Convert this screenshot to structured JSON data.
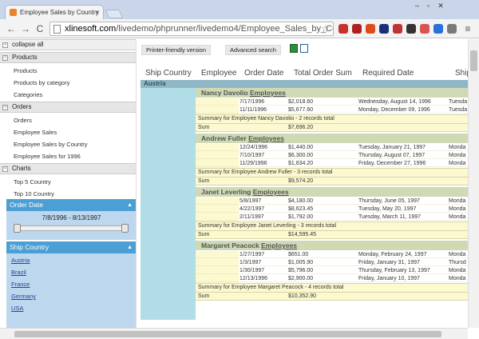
{
  "browser": {
    "tab_title": "Employee Sales by Country",
    "tab_close": "×",
    "url_host": "xlinesoft.com",
    "url_path": "/livedemo/phprunner/livedemo4/Employee_Sales_by_Country",
    "window_controls": "–▫✕",
    "back": "←",
    "forward": "→",
    "reload": "C",
    "star": "☆",
    "menu": "≡",
    "extension_colors": [
      "#c9302c",
      "#b02020",
      "#e04a1a",
      "#1a2f7a",
      "#c23232",
      "#333333",
      "#d9534f",
      "#2a6fdb",
      "#7a7a7a"
    ]
  },
  "sidebar": {
    "collapse_label": "collapse all",
    "sections": [
      {
        "toggle": "−",
        "title": "Products",
        "items": [
          "Products",
          "Products by category",
          "Categories"
        ]
      },
      {
        "toggle": "−",
        "title": "Orders",
        "items": [
          "Orders",
          "Employee Sales",
          "Employee Sales by Country",
          "Employee Sales for 1996"
        ]
      },
      {
        "toggle": "−",
        "title": "Charts",
        "items": [
          "Top 5 Country",
          "Top 10 Country"
        ]
      }
    ],
    "order_date": {
      "title": "Order Date",
      "range": "7/8/1996 - 8/13/1997"
    },
    "ship_country": {
      "title": "Ship Country",
      "countries": [
        "Austria",
        "Brazil",
        "France",
        "Germany",
        "USA"
      ]
    },
    "collapse_arrow": "▲"
  },
  "toolbar": {
    "printer_label": "Printer-friendly version",
    "search_label": "Advanced search"
  },
  "report": {
    "columns": [
      "Ship Country",
      "Employee",
      "Order Date",
      "Total Order Sum",
      "Required Date",
      "Ship"
    ],
    "country": "Austria",
    "employee_link": "Employees",
    "sum_label": "Sum",
    "groups": [
      {
        "name": "Nancy Davolio",
        "rows": [
          [
            "7/17/1996",
            "$2,018.60",
            "Wednesday, August 14, 1996",
            "Tuesda"
          ],
          [
            "11/11/1996",
            "$5,677.60",
            "Monday, December 09, 1996",
            "Tuesda"
          ]
        ],
        "summary": "Summary for Employee Nancy Davolio - 2 records total",
        "sum": "$7,696.20"
      },
      {
        "name": "Andrew Fuller",
        "rows": [
          [
            "12/24/1996",
            "$1,440.00",
            "Tuesday, January 21, 1997",
            "Monda"
          ],
          [
            "7/10/1997",
            "$6,300.00",
            "Thursday, August 07, 1997",
            "Monda"
          ],
          [
            "11/29/1996",
            "$1,834.20",
            "Friday, December 27, 1996",
            "Monda"
          ]
        ],
        "summary": "Summary for Employee Andrew Fuller - 3 records total",
        "sum": "$9,574.20"
      },
      {
        "name": "Janet Leverling",
        "rows": [
          [
            "5/8/1997",
            "$4,180.00",
            "Thursday, June 05, 1997",
            "Monda"
          ],
          [
            "4/22/1997",
            "$8,623.45",
            "Tuesday, May 20, 1997",
            "Monda"
          ],
          [
            "2/11/1997",
            "$1,792.00",
            "Tuesday, March 11, 1997",
            "Monda"
          ]
        ],
        "summary": "Summary for Employee Janet Leverling - 3 records total",
        "sum": "$14,595.45"
      },
      {
        "name": "Margaret Peacock",
        "rows": [
          [
            "1/27/1997",
            "$651.00",
            "Monday, February 24, 1997",
            "Monda"
          ],
          [
            "1/3/1997",
            "$1,005.90",
            "Friday, January 31, 1997",
            "Thursd"
          ],
          [
            "1/30/1997",
            "$5,796.00",
            "Thursday, February 13, 1997",
            "Monda"
          ],
          [
            "12/13/1996",
            "$2,900.00",
            "Friday, January 10, 1997",
            "Monda"
          ]
        ],
        "summary": "Summary for Employee Margaret Peacock - 4 records total",
        "sum": "$10,352.90"
      }
    ]
  }
}
